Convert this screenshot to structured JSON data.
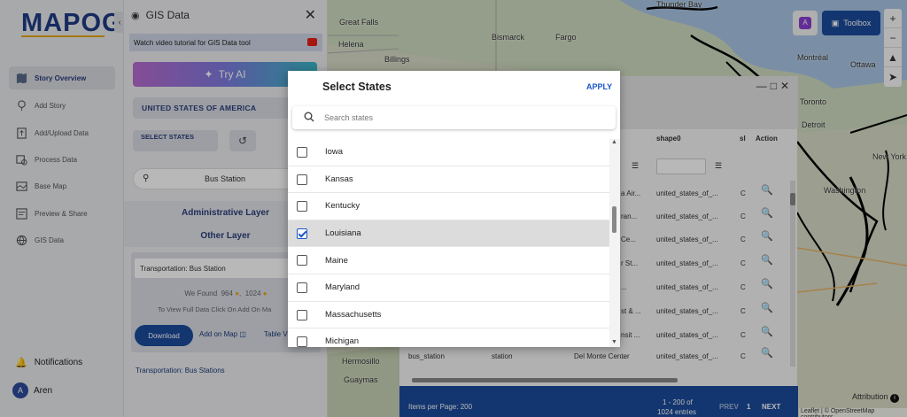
{
  "app": {
    "logo": "MAPOG"
  },
  "sidebar": {
    "items": [
      {
        "label": "Story Overview",
        "icon": "map-book-icon",
        "active": true
      },
      {
        "label": "Add Story",
        "icon": "location-pin-icon",
        "active": false
      },
      {
        "label": "Add/Upload Data",
        "icon": "upload-file-icon",
        "active": false
      },
      {
        "label": "Process Data",
        "icon": "process-data-icon",
        "active": false
      },
      {
        "label": "Base Map",
        "icon": "base-map-icon",
        "active": false
      },
      {
        "label": "Preview & Share",
        "icon": "preview-icon",
        "active": false
      },
      {
        "label": "GIS Data",
        "icon": "gis-data-icon",
        "active": false
      }
    ],
    "notifications": "Notifications",
    "user": {
      "initial": "A",
      "name": "Aren"
    }
  },
  "gis": {
    "title": "GIS Data",
    "tutorial": "Watch video tutorial for GIS Data tool",
    "try_ai": "Try AI",
    "country": "UNITED STATES OF AMERICA",
    "select_states": "SELECT STATES",
    "search_value": "Bus Station",
    "admin_layer": "Administrative Layer",
    "other_layer": "Other Layer",
    "card": {
      "caption": "Transportation: Bus Station",
      "found_prefix": "We Found",
      "found_count": "964",
      "found_total": "1024",
      "hint": "To View Full Data Click On Add On Ma",
      "download": "Download",
      "add_on_map": "Add on Map",
      "table_view": "Table V"
    },
    "bus_link": "Transportation: Bus Stations"
  },
  "map": {
    "labels": [
      {
        "text": "Thunder Bay"
      },
      {
        "text": "Great Falls"
      },
      {
        "text": "Helena"
      },
      {
        "text": "Bismarck"
      },
      {
        "text": "Fargo"
      },
      {
        "text": "Billings"
      },
      {
        "text": "Ottawa"
      },
      {
        "text": "Montréal"
      },
      {
        "text": "Toronto"
      },
      {
        "text": "Detroit"
      },
      {
        "text": "New York"
      },
      {
        "text": "Washington"
      },
      {
        "text": "Hermosillo"
      },
      {
        "text": "Guaymas"
      }
    ],
    "toolbox": "Toolbox",
    "attribution": "Attribution",
    "osm": "Leaflet | © OpenStreetMap contributors"
  },
  "data_panel": {
    "headers": [
      "shape0",
      "sl",
      "Action"
    ],
    "rows": [
      {
        "col1": "a Air...",
        "col2": "united_states_of_...",
        "col3": "C"
      },
      {
        "col1": "ran...",
        "col2": "united_states_of_...",
        "col3": "C"
      },
      {
        "col1": "Ce...",
        "col2": "united_states_of_...",
        "col3": "C"
      },
      {
        "col1": "r St...",
        "col2": "united_states_of_...",
        "col3": "C"
      },
      {
        "col1": "...",
        "col2": "united_states_of_...",
        "col3": "C"
      },
      {
        "col1": "st & ...",
        "col2": "united_states_of_...",
        "col3": "C"
      },
      {
        "col1": "nsit ...",
        "col2": "united_states_of_...",
        "col3": "C"
      },
      {
        "col1": "...",
        "col2": "united_states_of_...",
        "col3": "C"
      }
    ],
    "last_row": [
      "bus_station",
      "station",
      "Del Monte Center",
      "united_states_of_...",
      "C"
    ],
    "footer": {
      "items_per_page": "Items per Page: 200",
      "range": "1 - 200 of",
      "entries": "1024 entries",
      "prev": "PREV",
      "page": "1",
      "next": "NEXT"
    }
  },
  "modal": {
    "title": "Select States",
    "apply": "APPLY",
    "search_placeholder": "Search states",
    "states": [
      {
        "name": "Iowa",
        "checked": false
      },
      {
        "name": "Kansas",
        "checked": false
      },
      {
        "name": "Kentucky",
        "checked": false
      },
      {
        "name": "Louisiana",
        "checked": true
      },
      {
        "name": "Maine",
        "checked": false
      },
      {
        "name": "Maryland",
        "checked": false
      },
      {
        "name": "Massachusetts",
        "checked": false
      },
      {
        "name": "Michigan",
        "checked": false
      }
    ]
  }
}
